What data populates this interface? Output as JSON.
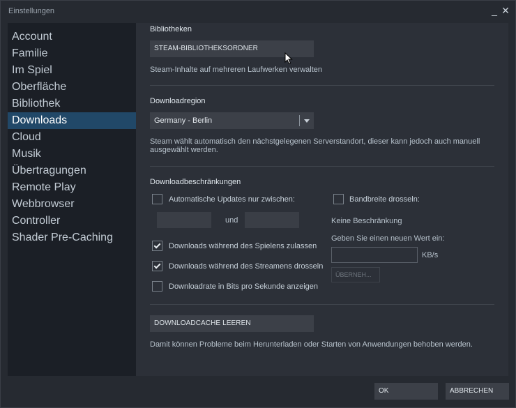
{
  "window": {
    "title": "Einstellungen",
    "minimize_glyph": "_",
    "close_glyph": "✕"
  },
  "sidebar": {
    "items": [
      {
        "label": "Account",
        "active": false
      },
      {
        "label": "Familie",
        "active": false
      },
      {
        "label": "Im Spiel",
        "active": false
      },
      {
        "label": "Oberfläche",
        "active": false
      },
      {
        "label": "Bibliothek",
        "active": false
      },
      {
        "label": "Downloads",
        "active": true
      },
      {
        "label": "Cloud",
        "active": false
      },
      {
        "label": "Musik",
        "active": false
      },
      {
        "label": "Übertragungen",
        "active": false
      },
      {
        "label": "Remote Play",
        "active": false
      },
      {
        "label": "Webbrowser",
        "active": false
      },
      {
        "label": "Controller",
        "active": false
      },
      {
        "label": "Shader Pre-Caching",
        "active": false
      }
    ]
  },
  "libraries": {
    "title": "Bibliotheken",
    "button_label": "STEAM-BIBLIOTHEKSORDNER",
    "description": "Steam-Inhalte auf mehreren Laufwerken verwalten"
  },
  "region": {
    "title": "Downloadregion",
    "selected": "Germany - Berlin",
    "description": "Steam wählt automatisch den nächstgelegenen Serverstandort, dieser kann jedoch auch manuell ausgewählt werden."
  },
  "restrictions": {
    "title": "Downloadbeschränkungen",
    "auto_updates_label": "Automatische Updates nur zwischen:",
    "auto_updates_checked": false,
    "time_from": "",
    "and_label": "und",
    "time_to": "",
    "allow_while_playing_label": "Downloads während des Spielens zulassen",
    "allow_while_playing_checked": true,
    "throttle_streaming_label": "Downloads während des Streamens drosseln",
    "throttle_streaming_checked": true,
    "bits_per_second_label": "Downloadrate in Bits pro Sekunde anzeigen",
    "bits_per_second_checked": false,
    "bandwidth_label": "Bandbreite drosseln:",
    "bandwidth_checked": false,
    "no_limit_text": "Keine Beschränkung",
    "enter_value_label": "Geben Sie einen neuen Wert ein:",
    "bandwidth_value": "",
    "unit": "KB/s",
    "apply_label": "ÜBERNEH..."
  },
  "cache": {
    "button_label": "DOWNLOADCACHE LEEREN",
    "description": "Damit können Probleme beim Herunterladen oder Starten von Anwendungen behoben werden."
  },
  "footer": {
    "ok_label": "OK",
    "cancel_label": "ABBRECHEN"
  },
  "colors": {
    "accent_active": "#214868",
    "sidebar_bg": "#1b1f26",
    "content_bg": "#2c3038",
    "button_bg": "#3c4048"
  }
}
